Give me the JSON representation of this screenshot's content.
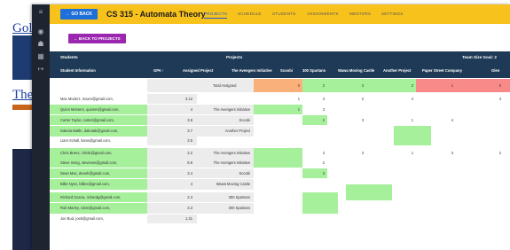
{
  "background": {
    "link1": "Gol",
    "link2": "The"
  },
  "header": {
    "go_back": "← GO BACK",
    "course_title": "CS 315 - Automata Theory",
    "tabs": [
      "PROJECTS",
      "SCHEDULE",
      "STUDENTS",
      "ASSIGNMENTS",
      "MENTORS",
      "SETTINGS"
    ],
    "active_tab": "PROJECTS"
  },
  "back_to_projects": "← BACK TO PROJECTS",
  "table": {
    "group_students": "Students",
    "group_projects": "Projects",
    "team_size_goal": "Team Size Goal: 2",
    "col_student": "Student Information",
    "col_gpa": "GPA ↑",
    "col_assigned": "Assigned Project",
    "projects": [
      "The Avengers Initiative",
      "Scoobi",
      "300 Spartans",
      "Wawa Moving Castle",
      "Another Project",
      "Paper Street Company",
      "Glen Hawk"
    ],
    "total_label": "Total Assigned",
    "totals": [
      "0",
      "2",
      "3",
      "2",
      "1",
      "0",
      "0"
    ],
    "rows": [
      {
        "email": "Max Moderz, maxm@gmail.com,",
        "gpa": "3.12",
        "project": "",
        "vals": [
          "1",
          "3",
          "2",
          "4",
          "",
          "3",
          ""
        ]
      },
      {
        "email": "Quinn Mersers, quinnm@gmail.com,",
        "gpa": "4",
        "project": "The Avengers Initiative",
        "vals": [
          "1",
          "3",
          "",
          "",
          "",
          "",
          ""
        ]
      },
      {
        "email": "Carter Taylor, cartert@gmail.com,",
        "gpa": "3.8",
        "project": "Scoobi",
        "vals": [
          "",
          "2",
          "3",
          "1",
          "4",
          "",
          ""
        ]
      },
      {
        "email": "Dakota Battle, dakotab@gmail.com,",
        "gpa": "3.7",
        "project": "Another Project",
        "vals": [
          "",
          "",
          "",
          "",
          "",
          "",
          ""
        ]
      },
      {
        "email": "Liam Schall, liams@gmail.com,",
        "gpa": "3.5",
        "project": "",
        "vals": [
          "",
          "",
          "",
          "",
          "",
          "",
          ""
        ]
      },
      {
        "email": "Chris Brees, chrisb@gmail.com,",
        "gpa": "3.2",
        "project": "The Avengers Initiative",
        "vals": [
          "",
          "2",
          "3",
          "1",
          "3",
          "2",
          ""
        ]
      },
      {
        "email": "Steve Irving, stevesee@gmail.com,",
        "gpa": "8.9",
        "project": "The Avengers Initiative",
        "vals": [
          "",
          "2",
          "",
          "",
          "",
          "",
          ""
        ]
      },
      {
        "email": "Dean Mac, deanh@gmail.com,",
        "gpa": "3.4",
        "project": "Scoobi",
        "vals": [
          "",
          "3",
          "",
          "",
          "",
          "",
          ""
        ]
      },
      {
        "email": "Billie Nyes, billiee@gmail.com,",
        "gpa": "4",
        "project": "Wawa Moving Castle",
        "vals": [
          "",
          "",
          "",
          "",
          "",
          "",
          ""
        ]
      },
      {
        "email": "Richard Garcia, richardg@gmail.com,",
        "gpa": "2.3",
        "project": "300 Spartans",
        "vals": [
          "",
          "",
          "",
          "",
          "",
          "",
          ""
        ]
      },
      {
        "email": "Rob Marley, robm@gmail.com,",
        "gpa": "3.3",
        "project": "300 Spartans",
        "vals": [
          "",
          "",
          "",
          "",
          "",
          "",
          ""
        ]
      },
      {
        "email": "Joe Bud, joeb@gmail.com,",
        "gpa": "1.31",
        "project": "",
        "vals": [
          "",
          "",
          "",
          "",
          "",
          "",
          ""
        ]
      }
    ]
  }
}
